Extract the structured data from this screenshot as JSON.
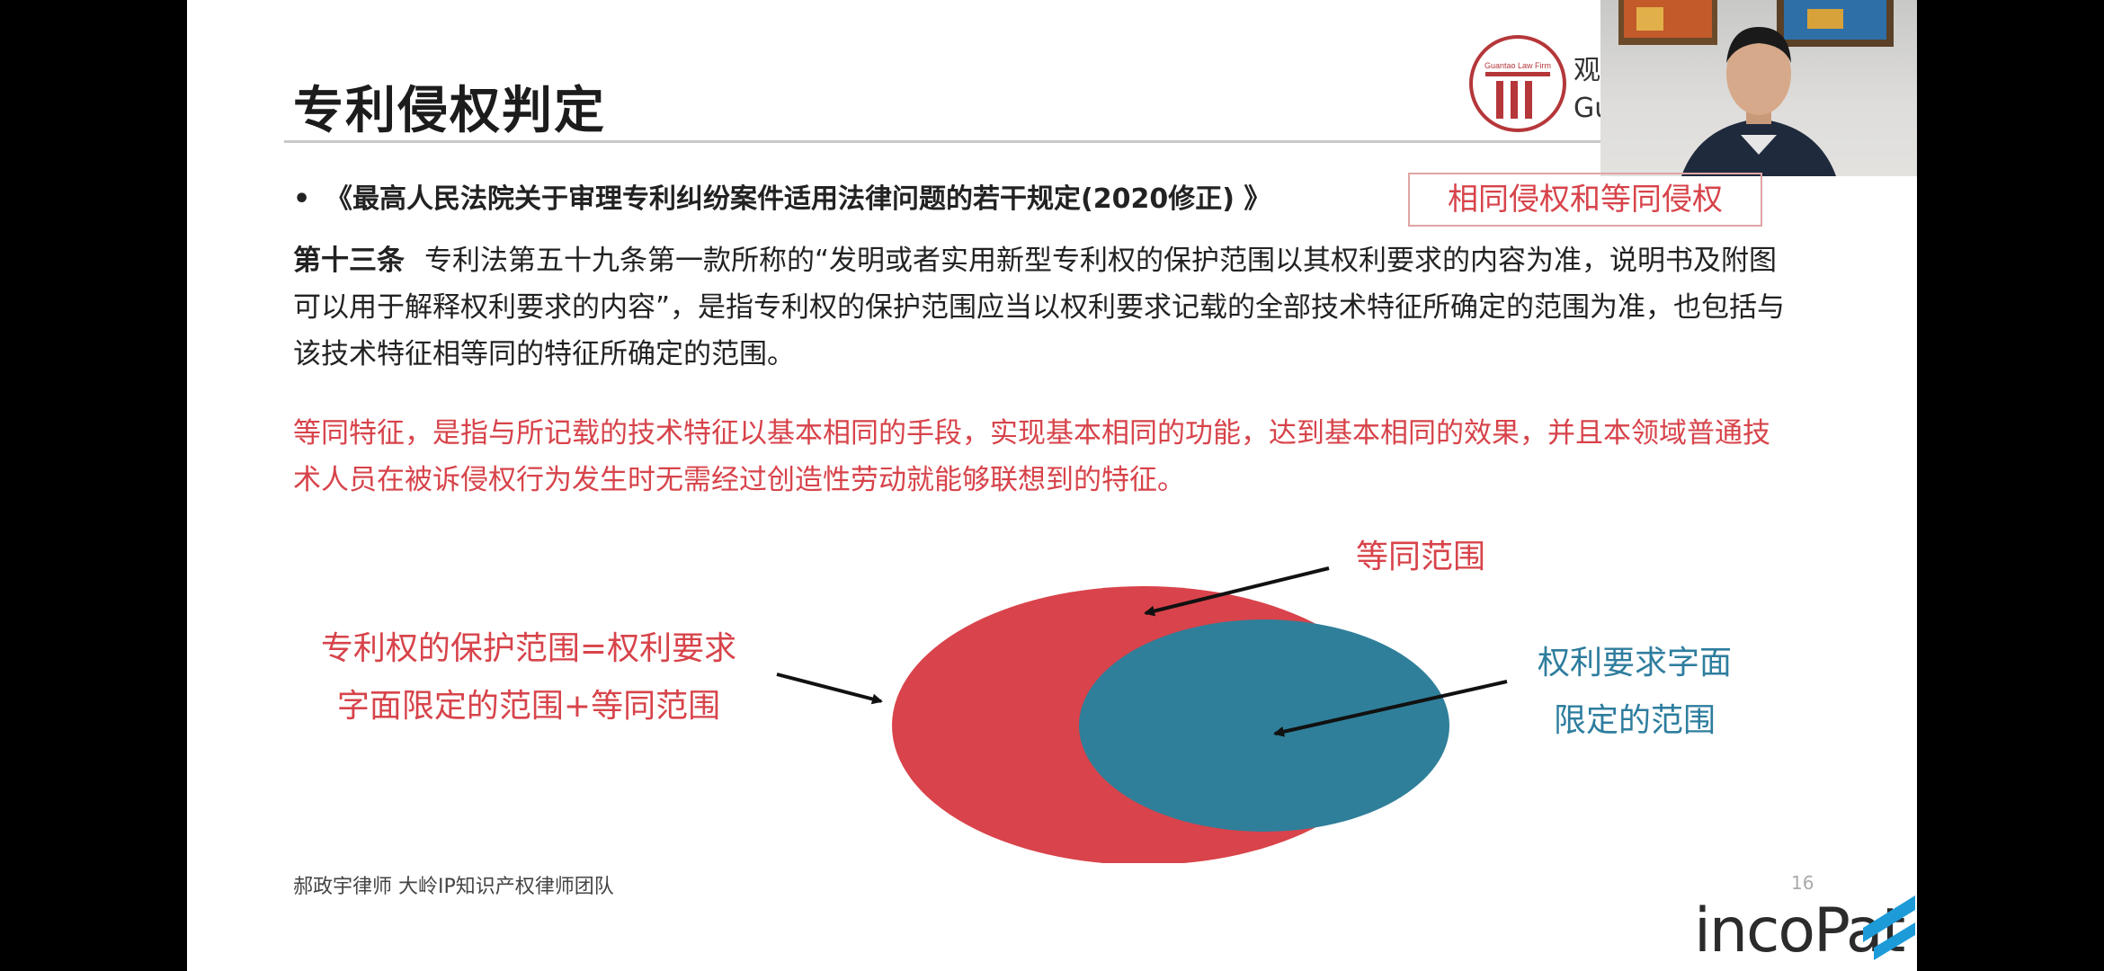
{
  "slide": {
    "title": "专利侵权判定",
    "bullet_marker": "•",
    "bullet_text": "《最高人民法院关于审理专利纠纷案件适用法律问题的若干规定(2020修正) 》",
    "tag": "相同侵权和等同侵权",
    "article_lead": "第十三条",
    "article_body": "专利法第五十九条第一款所称的“发明或者实用新型专利权的保护范围以其权利要求的内容为准，说明书及附图可以用于解释权利要求的内容”，是指专利权的保护范围应当以权利要求记载的全部技术特征所确定的范围为准，也包括与该技术特征相等同的特征所确定的范围。",
    "equivalent_def": "等同特征，是指与所记载的技术特征以基本相同的手段，实现基本相同的功能，达到基本相同的效果，并且本领域普通技术人员在被诉侵权行为发生时无需经过创造性劳动就能够联想到的特征。",
    "diagram": {
      "left_label_line1": "专利权的保护范围=权利要求",
      "left_label_line2": "字面限定的范围+等同范围",
      "top_label": "等同范围",
      "right_label_line1": "权利要求字面",
      "right_label_line2": "限定的范围",
      "outer_color": "#d9434b",
      "inner_color": "#2f7f9a"
    },
    "footer": "郝政宇律师 大岭IP知识产权律师团队",
    "page_number": "16",
    "brand_logo_text": "incoPat",
    "firm_logo_small_text": "Guantao Law Firm",
    "firm_name_partial": "观韬",
    "firm_name_en_partial": "Gu"
  },
  "colors": {
    "accent_red": "#d7434a",
    "accent_blue": "#2e7d9e",
    "logo_red": "#b5373a",
    "incopat_blue": "#1d9bd8"
  }
}
